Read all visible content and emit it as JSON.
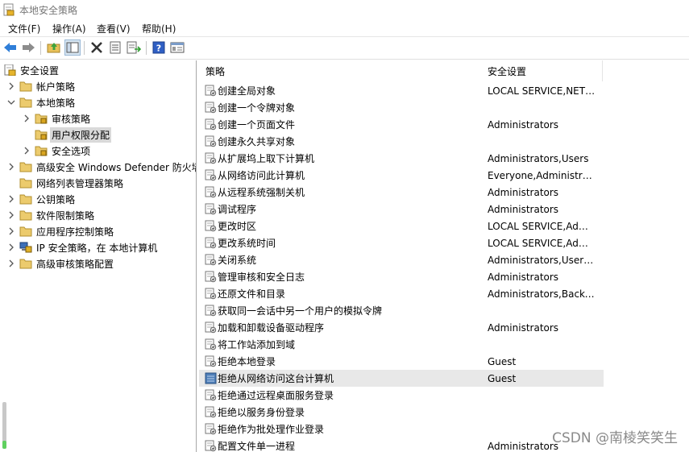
{
  "window": {
    "title": "本地安全策略"
  },
  "menu": [
    "文件(F)",
    "操作(A)",
    "查看(V)",
    "帮助(H)"
  ],
  "toolbar": {
    "buttons": [
      "back-icon",
      "forward-icon",
      "up-folder-icon",
      "show-hide-tree-icon",
      "delete-icon",
      "properties-icon",
      "export-list-icon",
      "help-icon",
      "view-toggle-icon"
    ]
  },
  "tree": {
    "items": [
      {
        "label": "安全设置",
        "level": 0,
        "expanded": true,
        "icon": "security-settings-icon"
      },
      {
        "label": "帐户策略",
        "level": 1,
        "expanded": false,
        "icon": "folder-icon"
      },
      {
        "label": "本地策略",
        "level": 1,
        "expanded": true,
        "icon": "folder-icon"
      },
      {
        "label": "审核策略",
        "level": 2,
        "expanded": false,
        "icon": "folder-lock-icon"
      },
      {
        "label": "用户权限分配",
        "level": 2,
        "expanded": null,
        "icon": "folder-lock-icon",
        "selected": true
      },
      {
        "label": "安全选项",
        "level": 2,
        "expanded": false,
        "icon": "folder-lock-icon"
      },
      {
        "label": "高级安全 Windows Defender 防火墙",
        "level": 1,
        "expanded": false,
        "icon": "folder-icon"
      },
      {
        "label": "网络列表管理器策略",
        "level": 1,
        "expanded": null,
        "icon": "folder-icon"
      },
      {
        "label": "公钥策略",
        "level": 1,
        "expanded": false,
        "icon": "folder-icon"
      },
      {
        "label": "软件限制策略",
        "level": 1,
        "expanded": false,
        "icon": "folder-icon"
      },
      {
        "label": "应用程序控制策略",
        "level": 1,
        "expanded": false,
        "icon": "folder-icon"
      },
      {
        "label": "IP 安全策略，在 本地计算机",
        "level": 1,
        "expanded": false,
        "icon": "ip-security-icon"
      },
      {
        "label": "高级审核策略配置",
        "level": 1,
        "expanded": false,
        "icon": "folder-icon"
      }
    ]
  },
  "list": {
    "columns": [
      "策略",
      "安全设置"
    ],
    "rows": [
      {
        "policy": "创建全局对象",
        "setting": "LOCAL SERVICE,NETWORK SERVICE,Administrators,SERVICE"
      },
      {
        "policy": "创建一个令牌对象",
        "setting": ""
      },
      {
        "policy": "创建一个页面文件",
        "setting": "Administrators"
      },
      {
        "policy": "创建永久共享对象",
        "setting": ""
      },
      {
        "policy": "从扩展坞上取下计算机",
        "setting": "Administrators,Users"
      },
      {
        "policy": "从网络访问此计算机",
        "setting": "Everyone,Administrators,Users,Backup Operators"
      },
      {
        "policy": "从远程系统强制关机",
        "setting": "Administrators"
      },
      {
        "policy": "调试程序",
        "setting": "Administrators"
      },
      {
        "policy": "更改时区",
        "setting": "LOCAL SERVICE,Administrators,Users"
      },
      {
        "policy": "更改系统时间",
        "setting": "LOCAL SERVICE,Administrators"
      },
      {
        "policy": "关闭系统",
        "setting": "Administrators,Users,Backup Operators"
      },
      {
        "policy": "管理审核和安全日志",
        "setting": "Administrators"
      },
      {
        "policy": "还原文件和目录",
        "setting": "Administrators,Backup Operators"
      },
      {
        "policy": "获取同一会话中另一个用户的模拟令牌",
        "setting": ""
      },
      {
        "policy": "加载和卸载设备驱动程序",
        "setting": "Administrators"
      },
      {
        "policy": "将工作站添加到域",
        "setting": ""
      },
      {
        "policy": "拒绝本地登录",
        "setting": "Guest"
      },
      {
        "policy": "拒绝从网络访问这台计算机",
        "setting": "Guest",
        "highlight": true
      },
      {
        "policy": "拒绝通过远程桌面服务登录",
        "setting": ""
      },
      {
        "policy": "拒绝以服务身份登录",
        "setting": ""
      },
      {
        "policy": "拒绝作为批处理作业登录",
        "setting": ""
      },
      {
        "policy": "配置文件单一进程",
        "setting": "Administrators"
      }
    ]
  },
  "watermark": "CSDN @南棱笑笑生"
}
